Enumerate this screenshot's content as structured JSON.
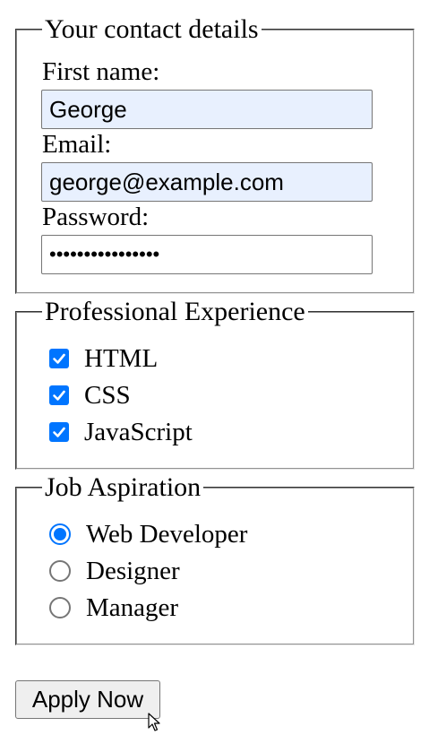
{
  "contact": {
    "legend": "Your contact details",
    "first_name_label": "First name:",
    "first_name_value": "George",
    "email_label": "Email:",
    "email_value": "george@example.com",
    "password_label": "Password:",
    "password_value": "••••••••••••••••"
  },
  "experience": {
    "legend": "Professional Experience",
    "options": [
      {
        "label": "HTML",
        "checked": true
      },
      {
        "label": "CSS",
        "checked": true
      },
      {
        "label": "JavaScript",
        "checked": true
      }
    ]
  },
  "aspiration": {
    "legend": "Job Aspiration",
    "options": [
      {
        "label": "Web Developer",
        "selected": true
      },
      {
        "label": "Designer",
        "selected": false
      },
      {
        "label": "Manager",
        "selected": false
      }
    ]
  },
  "actions": {
    "apply_label": "Apply Now"
  },
  "colors": {
    "accent": "#0075ff",
    "autofill_bg": "#e8f0fe"
  },
  "icons": {
    "checkmark": "checkmark-icon",
    "cursor": "mouse-pointer-icon"
  }
}
